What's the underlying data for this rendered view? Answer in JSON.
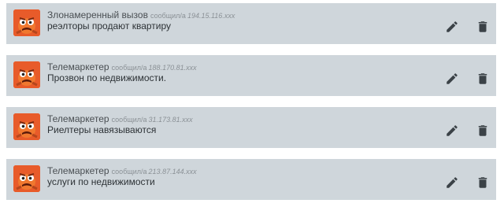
{
  "comments": [
    {
      "author": "Злонамеренный вызов",
      "verb": "сообщил/а",
      "ip": "194.15.116.xxx",
      "text": "реэлторы продают квартиру"
    },
    {
      "author": "Телемаркетер",
      "verb": "сообщил/а",
      "ip": "188.170.81.xxx",
      "text": "Прозвон по недвижимости."
    },
    {
      "author": "Телемаркетер",
      "verb": "сообщил/а",
      "ip": "31.173.81.xxx",
      "text": "Риелтеры навязываются"
    },
    {
      "author": "Телемаркетер",
      "verb": "сообщил/а",
      "ip": "213.87.144.xxx",
      "text": "услуги по недвижимости"
    }
  ],
  "icons": {
    "avatar": "angry-monster-avatar",
    "edit": "pencil-icon",
    "delete": "trash-icon"
  },
  "colors": {
    "card_background": "#cfd6db",
    "avatar_background": "#e85b2a",
    "icon_color": "#3b4247"
  }
}
